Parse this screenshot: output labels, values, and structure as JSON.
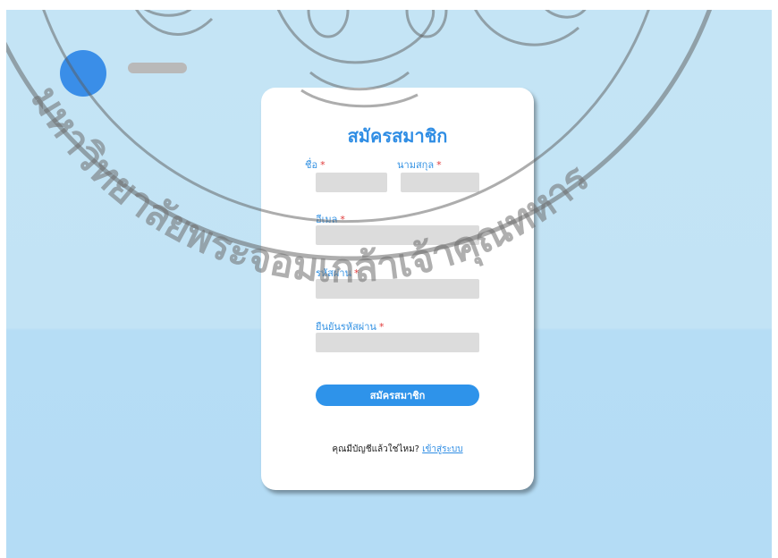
{
  "watermark": {
    "text": "มหาวิทยาลัยพระจอมเกล้าเจ้าคุณทหาร"
  },
  "form": {
    "title": "สมัครสมาชิก",
    "first_name_label": "ชื่อ",
    "last_name_label": "นามสกุล",
    "email_label": "อีเมล",
    "password_label": "รหัสผ่าน",
    "confirm_label": "ยืนยันรหัสผ่าน",
    "required_mark": "*",
    "submit_label": "สมัครสมาชิก",
    "have_account_text": "คุณมีบัญชีแล้วใช่ไหม?",
    "login_link": "เข้าสู่ระบบ"
  },
  "colors": {
    "page_bg_top": "#c4e4f5",
    "page_bg_bottom": "#b4dcf5",
    "accent": "#2e93ea",
    "field_bg": "#dcdcdc",
    "required": "#e03a3a"
  }
}
